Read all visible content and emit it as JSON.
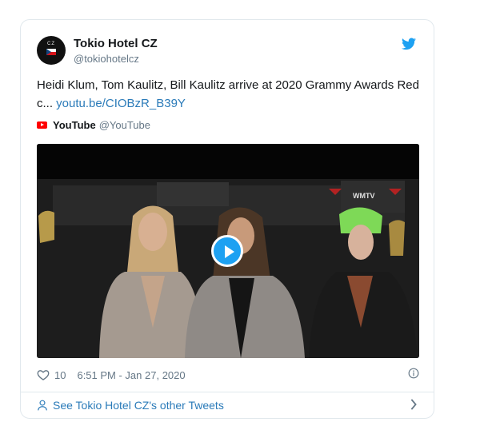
{
  "account": {
    "name": "Tokio Hotel CZ",
    "handle": "@tokiohotelcz",
    "avatar_icon": "tokio-hotel-cz-logo"
  },
  "tweet": {
    "text": "Heidi Klum, Tom Kaulitz, Bill Kaulitz arrive at 2020 Grammy Awards Red c... ",
    "link": "youtu.be/CIOBzR_B39Y"
  },
  "source": {
    "name": "YouTube",
    "handle": "@YouTube"
  },
  "video": {
    "watermark": "WMTV",
    "play_icon": "play-icon"
  },
  "footer": {
    "likes": "10",
    "timestamp": "6:51 PM - Jan 27, 2020",
    "other_tweets": "See Tokio Hotel CZ's other Tweets"
  },
  "colors": {
    "link": "#2b7bb9",
    "twitter_blue": "#1da1f2",
    "youtube_red": "#ff0000",
    "muted": "#657786"
  }
}
